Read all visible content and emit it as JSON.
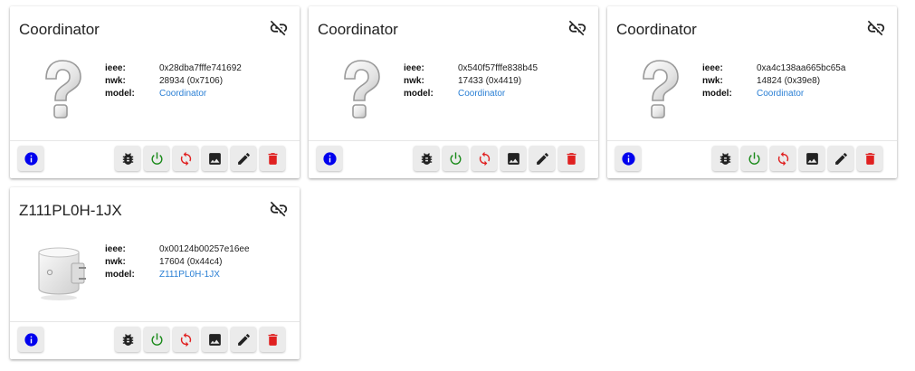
{
  "labels": {
    "ieee": "ieee:",
    "nwk": "nwk:",
    "model": "model:"
  },
  "colors": {
    "info": "#0000ee",
    "power": "#1a8a1a",
    "danger": "#e02020",
    "link": "#2a7fd4"
  },
  "devices": [
    {
      "title": "Coordinator",
      "ieee": "0x28dba7fffe741692",
      "nwk": "28934 (0x7106)",
      "model": "Coordinator",
      "image": "question-mark"
    },
    {
      "title": "Coordinator",
      "ieee": "0x540f57fffe838b45",
      "nwk": "17433 (0x4419)",
      "model": "Coordinator",
      "image": "question-mark"
    },
    {
      "title": "Coordinator",
      "ieee": "0xa4c138aa665bc65a",
      "nwk": "14824 (0x39e8)",
      "model": "Coordinator",
      "image": "question-mark"
    },
    {
      "title": "Z111PL0H-1JX",
      "ieee": "0x00124b00257e16ee",
      "nwk": "17604 (0x44c4)",
      "model": "Z111PL0H-1JX",
      "image": "smart-plug"
    }
  ]
}
